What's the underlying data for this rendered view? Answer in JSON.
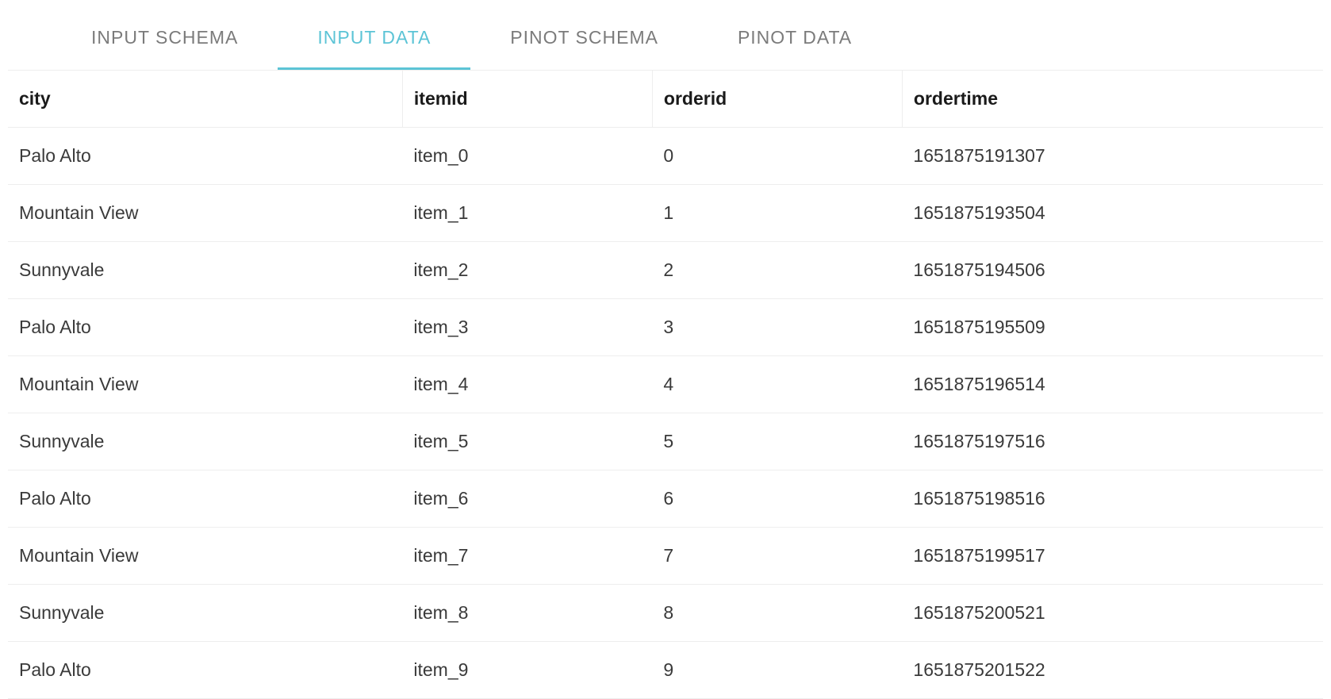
{
  "tabs": [
    {
      "label": "INPUT SCHEMA",
      "active": false
    },
    {
      "label": "INPUT DATA",
      "active": true
    },
    {
      "label": "PINOT SCHEMA",
      "active": false
    },
    {
      "label": "PINOT DATA",
      "active": false
    }
  ],
  "columns": [
    "city",
    "itemid",
    "orderid",
    "ordertime"
  ],
  "rows": [
    {
      "city": "Palo Alto",
      "itemid": "item_0",
      "orderid": "0",
      "ordertime": "1651875191307"
    },
    {
      "city": "Mountain View",
      "itemid": "item_1",
      "orderid": "1",
      "ordertime": "1651875193504"
    },
    {
      "city": "Sunnyvale",
      "itemid": "item_2",
      "orderid": "2",
      "ordertime": "1651875194506"
    },
    {
      "city": "Palo Alto",
      "itemid": "item_3",
      "orderid": "3",
      "ordertime": "1651875195509"
    },
    {
      "city": "Mountain View",
      "itemid": "item_4",
      "orderid": "4",
      "ordertime": "1651875196514"
    },
    {
      "city": "Sunnyvale",
      "itemid": "item_5",
      "orderid": "5",
      "ordertime": "1651875197516"
    },
    {
      "city": "Palo Alto",
      "itemid": "item_6",
      "orderid": "6",
      "ordertime": "1651875198516"
    },
    {
      "city": "Mountain View",
      "itemid": "item_7",
      "orderid": "7",
      "ordertime": "1651875199517"
    },
    {
      "city": "Sunnyvale",
      "itemid": "item_8",
      "orderid": "8",
      "ordertime": "1651875200521"
    },
    {
      "city": "Palo Alto",
      "itemid": "item_9",
      "orderid": "9",
      "ordertime": "1651875201522"
    }
  ]
}
